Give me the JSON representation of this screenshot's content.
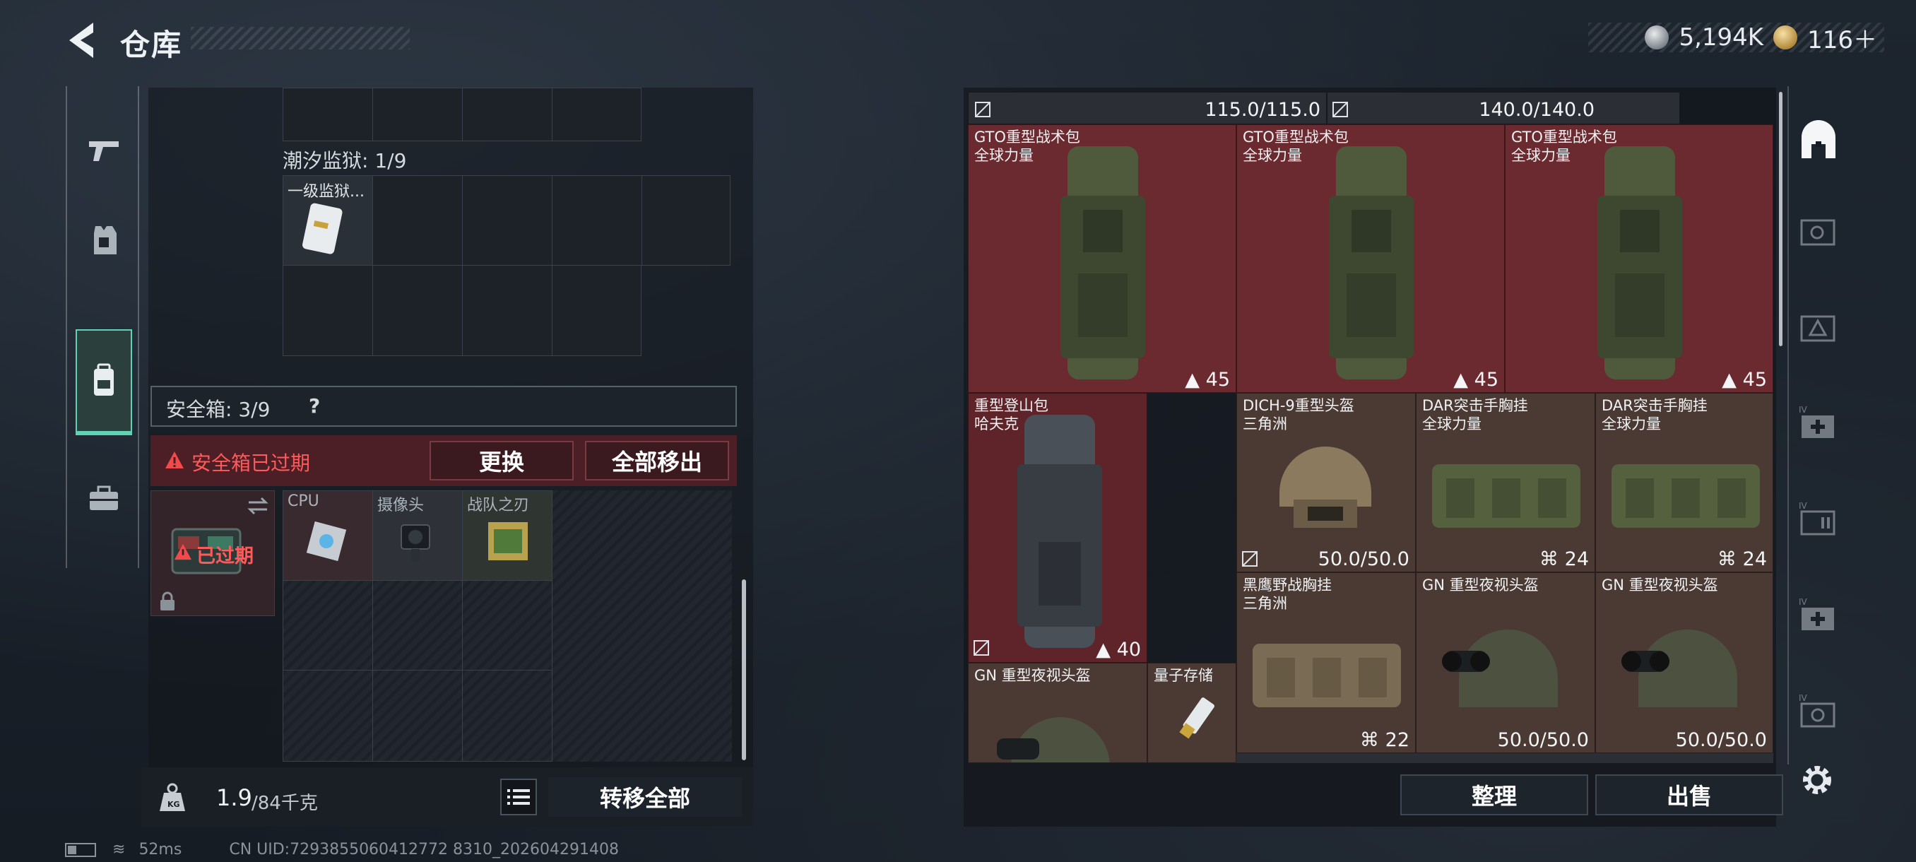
{
  "header": {
    "title": "仓库",
    "silver_amount": "5,194K",
    "gold_amount": "116＋"
  },
  "sidebar": {
    "items": [
      {
        "name": "weapon"
      },
      {
        "name": "armor"
      },
      {
        "name": "backpack",
        "active": true
      },
      {
        "name": "toolbox"
      }
    ]
  },
  "left_panel": {
    "prison_label": "潮汐监狱: 1/9",
    "prison_item_name": "一级监狱...",
    "safe_label": "安全箱: 3/9",
    "safe_help": "?",
    "warning_text": "安全箱已过期",
    "replace_button": "更换",
    "move_all_out_button": "全部移出",
    "expired_badge": "已过期",
    "slots": [
      "CPU",
      "摄像头",
      "战队之刃"
    ],
    "weight_value": "1.9",
    "weight_max": "/84千克",
    "transfer_all_button": "转移全部"
  },
  "right_panel": {
    "top_row": [
      "115.0/115.0",
      "140.0/140.0"
    ],
    "items": [
      {
        "name": "GTO重型战术包",
        "sub": "全球力量",
        "stat": "45"
      },
      {
        "name": "GTO重型战术包",
        "sub": "全球力量",
        "stat": "45"
      },
      {
        "name": "GTO重型战术包",
        "sub": "全球力量",
        "stat": "45"
      },
      {
        "name": "重型登山包",
        "sub": "哈夫克",
        "stat": "40"
      },
      {
        "name": "DICH-9重型头盔",
        "sub": "三角洲",
        "stat": "50.0/50.0"
      },
      {
        "name": "DAR突击手胸挂",
        "sub": "全球力量",
        "stat": "24"
      },
      {
        "name": "DAR突击手胸挂",
        "sub": "全球力量",
        "stat": "24"
      },
      {
        "name": "黑鹰野战胸挂",
        "sub": "三角洲",
        "stat": "22"
      },
      {
        "name": "GN 重型夜视头盔",
        "sub": "",
        "stat": "50.0/50.0"
      },
      {
        "name": "GN 重型夜视头盔",
        "sub": "",
        "stat": "50.0/50.0"
      },
      {
        "name": "GN 重型夜视头盔",
        "sub": "",
        "stat": ""
      },
      {
        "name": "量子存储",
        "sub": "",
        "stat": ""
      }
    ],
    "sort_button": "整理",
    "sell_button": "出售"
  },
  "status": {
    "ping": "52ms",
    "uid": "CN UID:7293855060412772 8310_202604291408"
  }
}
